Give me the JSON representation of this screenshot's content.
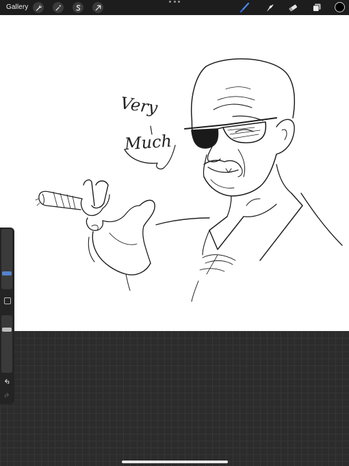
{
  "toolbar": {
    "gallery_label": "Gallery",
    "left_tools": [
      "wrench-icon",
      "magic-wand-icon",
      "selection-s-icon",
      "transform-arrow-icon"
    ],
    "right_tools": [
      "brush-icon",
      "smudge-icon",
      "eraser-icon",
      "layers-icon"
    ],
    "active_tool": "brush-icon",
    "accent_color": "#4a8cff",
    "current_color": "#000000"
  },
  "canvas": {
    "background": "#ffffff",
    "handwriting": {
      "line1": "Very",
      "line2": "Much"
    }
  },
  "sidebar": {
    "brush_size_level": 0.8,
    "opacity_level": 0.25,
    "icons": [
      "modify-square-icon",
      "undo-icon",
      "redo-icon"
    ]
  },
  "colors": {
    "toolbar_bg": "#1d1d1d",
    "grid_bg": "#2c2c2c",
    "sidebar_bg": "#242424"
  }
}
